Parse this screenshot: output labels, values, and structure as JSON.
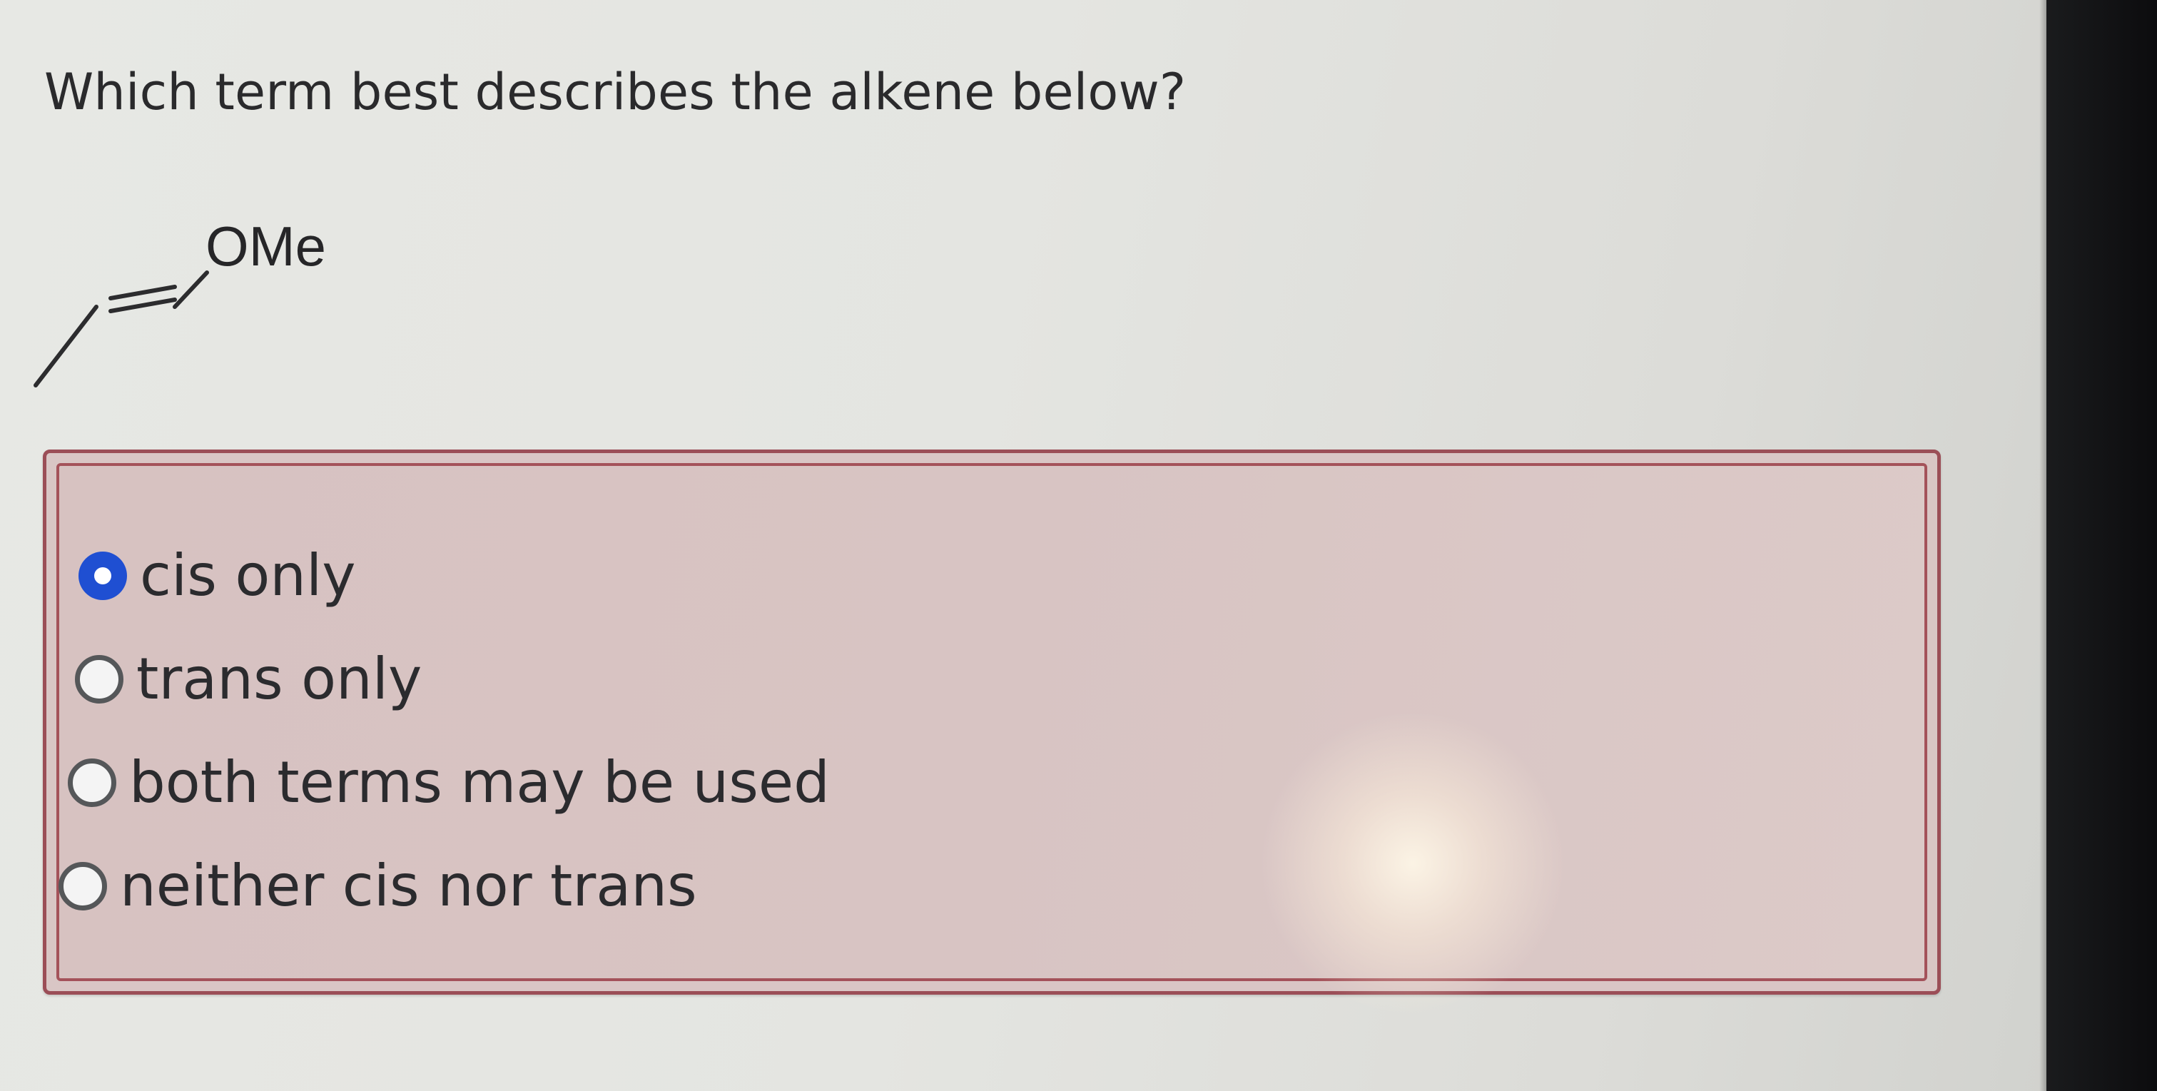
{
  "question": {
    "text": "Which term best describes the alkene below?"
  },
  "structure": {
    "substituent_label": "OMe"
  },
  "options": [
    {
      "label": "cis only",
      "selected": true
    },
    {
      "label": "trans only",
      "selected": false
    },
    {
      "label": "both terms may be used",
      "selected": false
    },
    {
      "label": "neither cis nor trans",
      "selected": false
    }
  ],
  "colors": {
    "selected_radio": "#1f4fd2",
    "answer_border": "#9b4e57",
    "answer_background": "#d9c6c5"
  }
}
